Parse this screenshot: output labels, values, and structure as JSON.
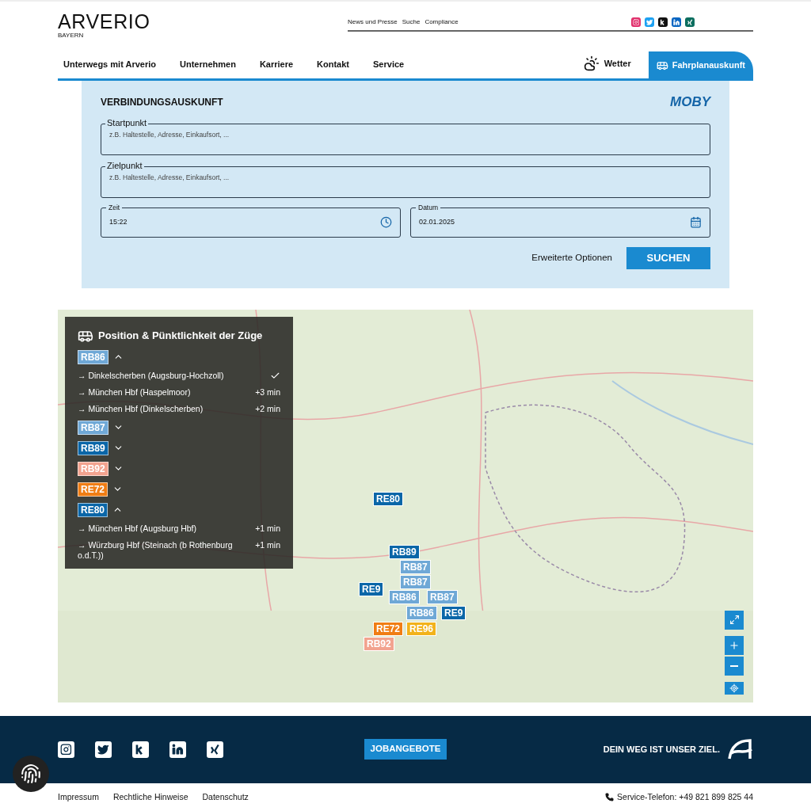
{
  "header": {
    "logo": "ARVERIO",
    "logo_sub": "BAYERN",
    "top_links": [
      "News und Presse",
      "Suche",
      "Compliance"
    ],
    "nav": [
      {
        "label": "Unterwegs mit Arverio",
        "selected": false
      },
      {
        "label": "Unternehmen",
        "selected": false
      },
      {
        "label": "Karriere",
        "selected": false
      },
      {
        "label": "Kontakt",
        "selected": false
      },
      {
        "label": "Service",
        "selected": false
      }
    ],
    "weather": "Wetter",
    "timetable": {
      "label": "Fahrplanauskunft",
      "selected": true
    }
  },
  "search": {
    "title": "VERBINDUNGSAUSKUNFT",
    "brand": "MOBY",
    "fields": [
      {
        "label": "Startpunkt",
        "placeholder": "z.B. Haltestelle, Adresse, Einkaufsort, ..."
      },
      {
        "label": "Zielpunkt",
        "placeholder": "z.B. Haltestelle, Adresse, Einkaufsort, ..."
      }
    ],
    "time": {
      "label": "Zeit",
      "value": "15:22"
    },
    "date": {
      "label": "Datum",
      "value": "02.01.2025"
    },
    "options": "Erweiterte Optionen",
    "submit": "SUCHEN"
  },
  "map": {
    "panel_title": "Position & Pünktlichkeit der Züge",
    "lines": [
      {
        "code": "RB86",
        "color": "#6fa8d6",
        "expanded": true,
        "trips": [
          {
            "kind": "on_time",
            "destination": "→ Dinkelscherben (Augsburg-Hochzoll)"
          },
          {
            "kind": "delay",
            "destination": "→ München Hbf (Haspelmoor)",
            "delay": "+3 min"
          },
          {
            "kind": "delay",
            "destination": "→ München Hbf (Dinkelscherben)",
            "delay": "+2 min"
          }
        ]
      },
      {
        "code": "RB87",
        "color": "#6fa8d6",
        "expanded": false
      },
      {
        "code": "RB89",
        "color": "#0a66a8",
        "expanded": false
      },
      {
        "code": "RB92",
        "color": "#f2a38f",
        "expanded": false
      },
      {
        "code": "RE72",
        "color": "#f07d14",
        "expanded": false
      },
      {
        "code": "RE80",
        "color": "#0a66a8",
        "expanded": true,
        "trips": [
          {
            "kind": "delay",
            "destination": "→ München Hbf (Augsburg Hbf)",
            "delay": "+1 min"
          },
          {
            "kind": "delay",
            "destination": "→ Würzburg Hbf (Steinach (b Rothenburg o.d.T.))",
            "delay": "+1 min"
          }
        ]
      }
    ],
    "markers": [
      {
        "code": "RE80",
        "color": "#0a66a8"
      },
      {
        "code": "RB89",
        "color": "#0a66a8"
      },
      {
        "code": "RB87",
        "color": "#6fa8d6"
      },
      {
        "code": "RB87",
        "color": "#6fa8d6"
      },
      {
        "code": "RE9",
        "color": "#0a66a8"
      },
      {
        "code": "RB86",
        "color": "#6fa8d6"
      },
      {
        "code": "RB87",
        "color": "#6fa8d6"
      },
      {
        "code": "RB86",
        "color": "#6fa8d6"
      },
      {
        "code": "RE9",
        "color": "#0a66a8"
      },
      {
        "code": "RE72",
        "color": "#f07d14"
      },
      {
        "code": "RE96",
        "color": "#f2b21b"
      },
      {
        "code": "RB92",
        "color": "#f2a38f"
      }
    ]
  },
  "footer": {
    "jobs": "JOBANGEBOTE",
    "slogan": "DEIN WEG IST UNSER ZIEL.",
    "links": [
      "Impressum",
      "Rechtliche Hinweise",
      "Datenschutz"
    ],
    "phone": "Service-Telefon: +49 821 899 825 44"
  }
}
